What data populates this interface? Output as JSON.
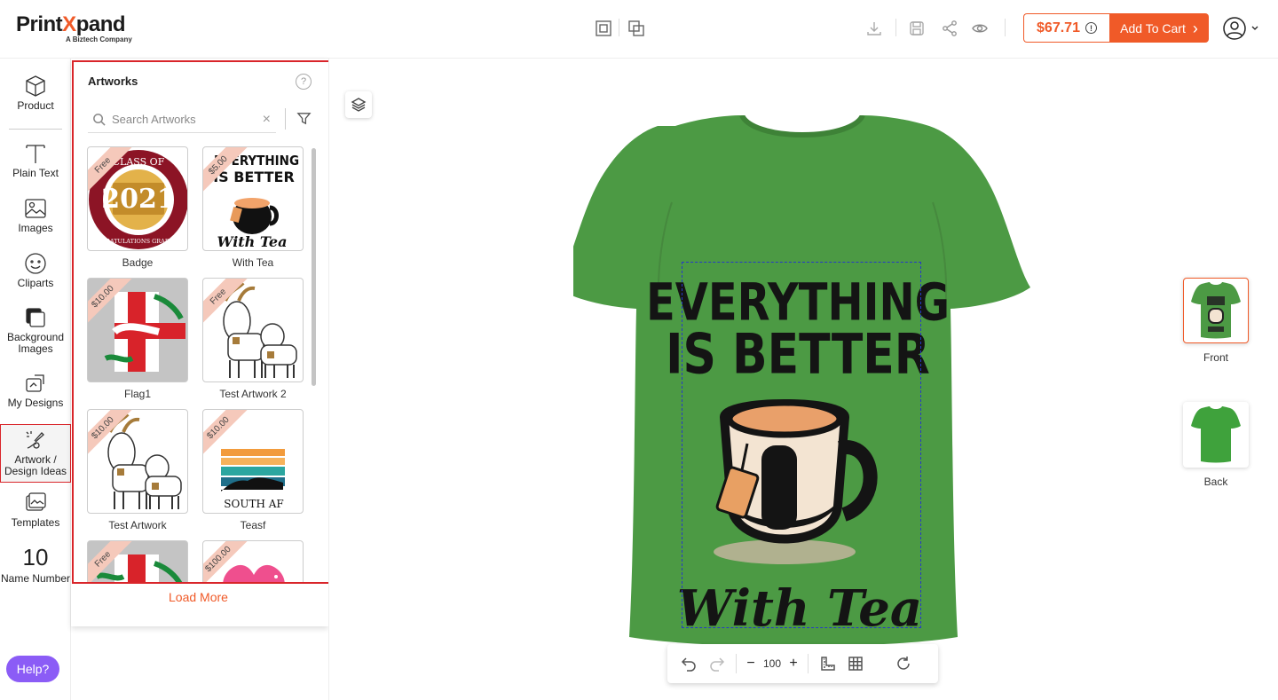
{
  "brand": {
    "name_part1": "Print",
    "name_x": "X",
    "name_part2": "pand",
    "tagline": "A Biztech Company",
    "accent": "#f05a28"
  },
  "header": {
    "icons": [
      "front-back-view-icon",
      "duplicate-view-icon",
      "download-icon",
      "save-icon",
      "share-icon",
      "preview-icon"
    ],
    "price": "$67.71",
    "price_info_icon": "!",
    "add_to_cart": "Add To Cart",
    "add_to_cart_chevron": "›"
  },
  "rail": {
    "items": [
      {
        "label": "Product",
        "icon": "cube-icon"
      },
      {
        "label": "Plain Text",
        "icon": "text-icon"
      },
      {
        "label": "Images",
        "icon": "image-icon"
      },
      {
        "label": "Cliparts",
        "icon": "smiley-icon"
      },
      {
        "label": "Background Images",
        "icon": "background-image-icon"
      },
      {
        "label": "My Designs",
        "icon": "my-designs-icon"
      },
      {
        "label": "Artwork / Design Ideas",
        "icon": "artwork-icon",
        "active": true
      },
      {
        "label": "Templates",
        "icon": "templates-icon"
      },
      {
        "label": "Name Number",
        "icon": "name-number-icon",
        "glyph": "10"
      }
    ],
    "help": "Help?"
  },
  "panel": {
    "title": "Artworks",
    "help_glyph": "?",
    "search_placeholder": "Search Artworks",
    "clear_glyph": "×",
    "cards": [
      {
        "label": "Badge",
        "ribbon": "Free"
      },
      {
        "label": "With Tea",
        "ribbon": "$5.00"
      },
      {
        "label": "Flag1",
        "ribbon": "$10.00"
      },
      {
        "label": "Test Artwork 2",
        "ribbon": "Free"
      },
      {
        "label": "Test Artwork",
        "ribbon": "$10.00"
      },
      {
        "label": "Teasf",
        "ribbon": "$10.00"
      },
      {
        "label": "",
        "ribbon": "Free"
      },
      {
        "label": "",
        "ribbon": "$100.00"
      }
    ],
    "load_more": "Load More"
  },
  "artwork_text": {
    "badge_top": "CLASS OF",
    "badge_year": "2021",
    "badge_bottom": "CONGRATULATIONS GRADUATES",
    "tea_line1": "EVERYTHING",
    "tea_line2": "IS BETTER",
    "tea_line3": "With Tea",
    "teasf_line": "SOUTH AF"
  },
  "toolbar": {
    "zoom": "100",
    "minus": "−",
    "plus": "+"
  },
  "views": [
    {
      "label": "Front",
      "selected": true
    },
    {
      "label": "Back",
      "selected": false
    }
  ],
  "colors": {
    "shirt": "#4c9a44",
    "accent": "#f05a28",
    "active_border": "#d9252a",
    "help": "#8b5cf6"
  }
}
